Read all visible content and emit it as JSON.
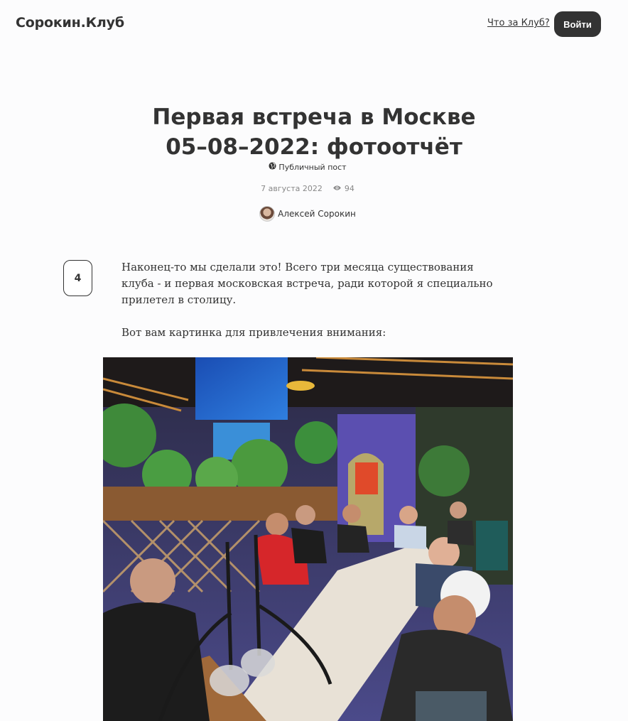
{
  "header": {
    "logo": "Сорокин.Клуб",
    "about_link": "Что за Клуб?",
    "login_button": "Войти"
  },
  "post": {
    "title_line1": "Первая встреча в Москве",
    "title_line2": "05–08–2022: фотоотчёт",
    "visibility": "Публичный пост",
    "date": "7 августа 2022",
    "views": "94",
    "author": "Алексей Сорокин",
    "upvotes": "4",
    "paragraphs": [
      "Наконец-то мы сделали это! Всего три месяца существования клуба - и первая московская встреча, ради которой я специально прилетел в столицу.",
      "Вот вам картинка для привлечения внимания:"
    ]
  },
  "colors": {
    "text": "#333333",
    "muted": "#888888",
    "button_bg": "#333333",
    "page_bg": "#fcfcfd"
  },
  "icons": [
    "globe-icon",
    "eye-icon"
  ]
}
